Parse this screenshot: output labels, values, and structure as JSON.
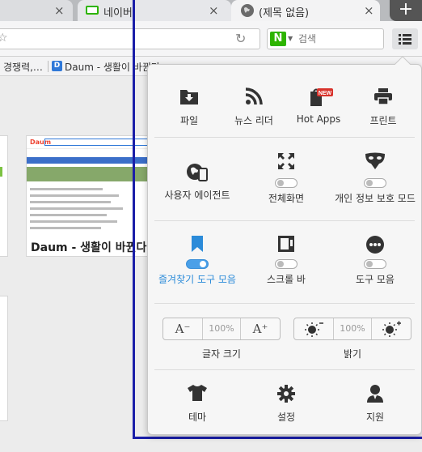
{
  "tabs": [
    {
      "label": ""
    },
    {
      "label": "네이버"
    },
    {
      "label": "(제목 없음)"
    }
  ],
  "new_tab_symbol": "+",
  "close_symbol": "×",
  "search": {
    "engine_letter": "N",
    "placeholder": "검색"
  },
  "bookmarks": [
    {
      "label": "경쟁력,…"
    },
    {
      "label": "Daum - 생활이 바뀐다"
    }
  ],
  "thumbnail": {
    "caption": "Daum - 생활이 바뀐다"
  },
  "menu": {
    "row1": [
      {
        "label": "파일",
        "icon": "download-icon"
      },
      {
        "label": "뉴스 리더",
        "icon": "rss-icon"
      },
      {
        "label": "Hot Apps",
        "icon": "hot-apps-icon",
        "badge": "NEW"
      },
      {
        "label": "프린트",
        "icon": "printer-icon"
      }
    ],
    "row2": [
      {
        "label": "사용자 에이전트",
        "icon": "user-agent-icon"
      },
      {
        "label": "전체화면",
        "icon": "fullscreen-icon",
        "toggle": false
      },
      {
        "label": "개인 정보 보호 모드",
        "icon": "mask-icon",
        "toggle": false
      }
    ],
    "row3": [
      {
        "label": "즐겨찾기 도구 모음",
        "icon": "bookmark-icon",
        "toggle": true
      },
      {
        "label": "스크롤 바",
        "icon": "scrollbar-icon",
        "toggle": false
      },
      {
        "label": "도구 모음",
        "icon": "more-icon",
        "toggle": false
      }
    ],
    "text_size": {
      "label": "글자 크기",
      "decrease": "A⁻",
      "value": "100%",
      "increase": "A⁺"
    },
    "brightness": {
      "label": "밝기",
      "value": "100%"
    },
    "row5": [
      {
        "label": "테마",
        "icon": "tshirt-icon"
      },
      {
        "label": "설정",
        "icon": "gear-icon"
      },
      {
        "label": "지원",
        "icon": "support-icon"
      }
    ]
  },
  "colors": {
    "accent": "#2b8bd9",
    "naver_green": "#2db400",
    "focus_line": "#1a1ea8"
  }
}
